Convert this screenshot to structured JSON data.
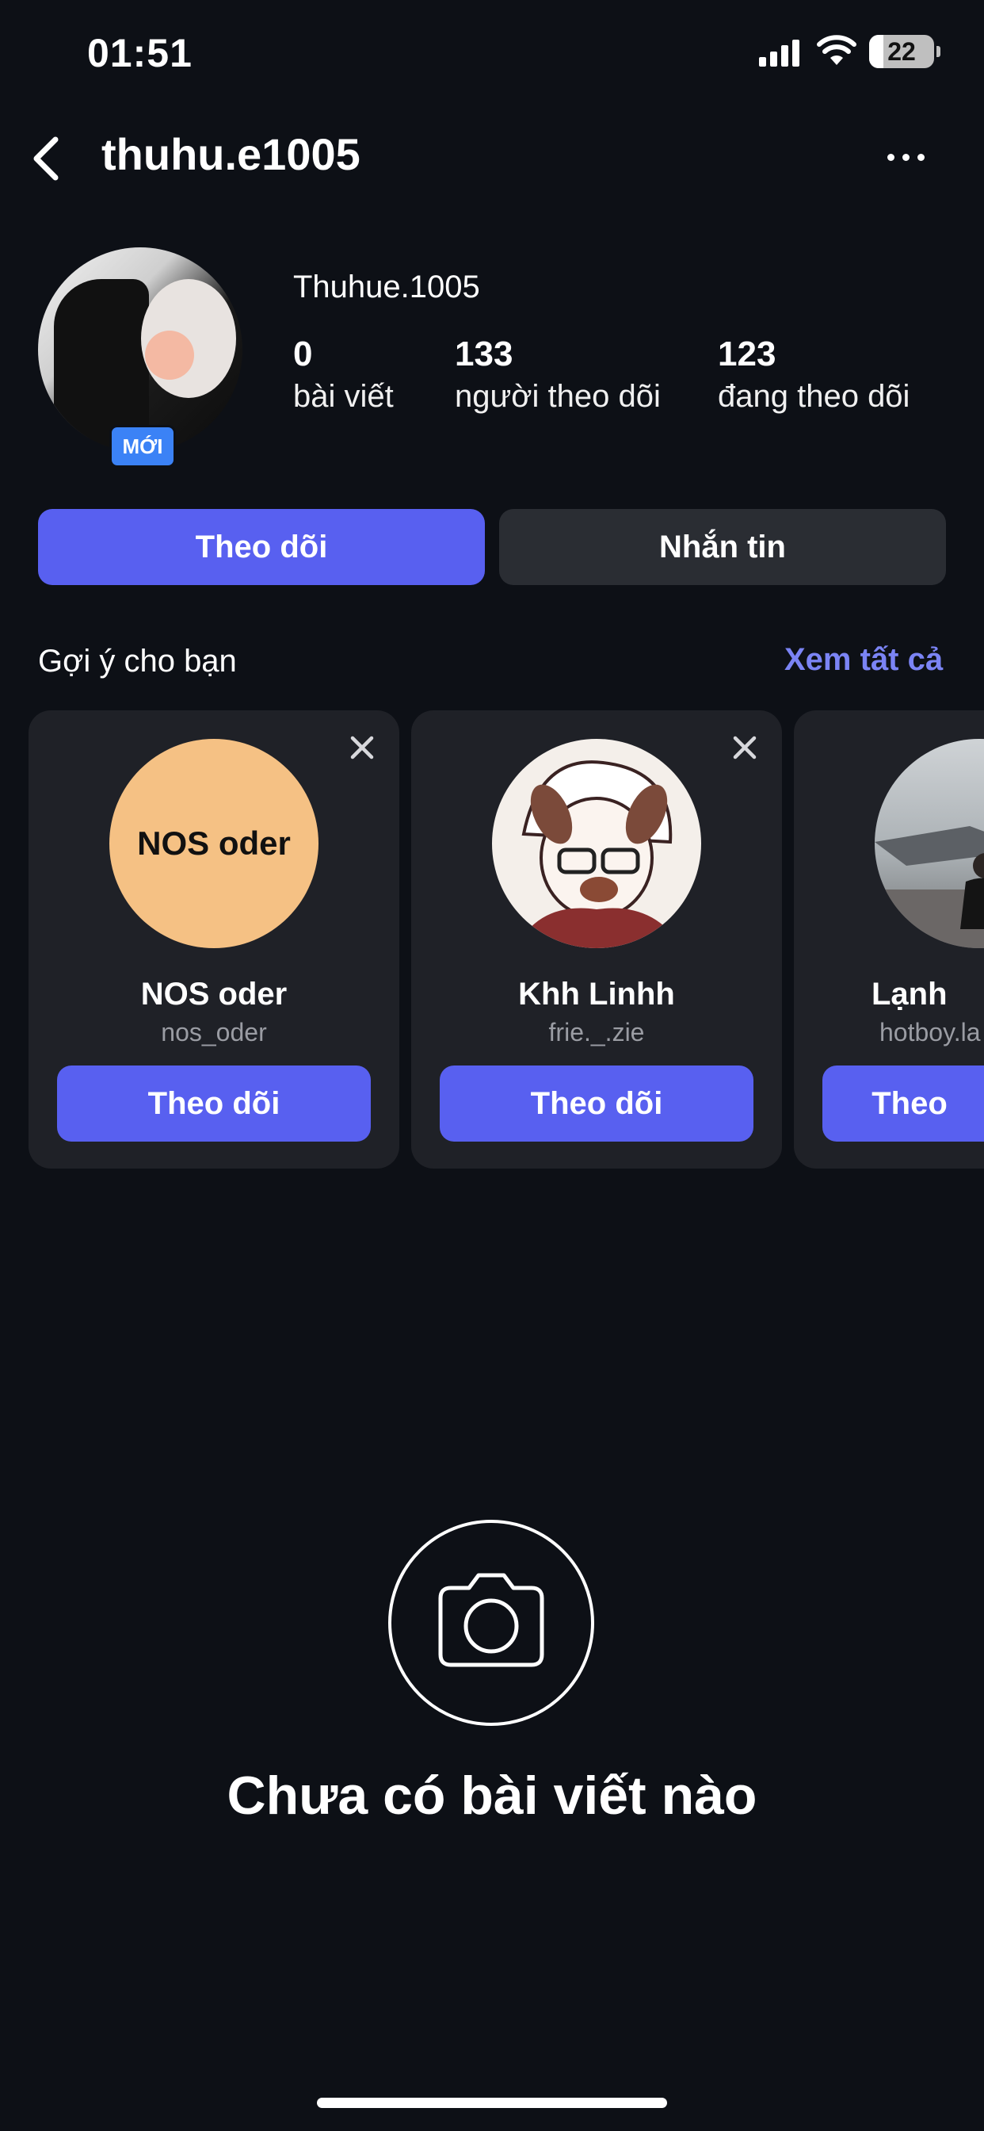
{
  "status_bar": {
    "time": "01:51",
    "battery": "22"
  },
  "header": {
    "username": "thuhu.e1005"
  },
  "profile": {
    "display_name": "Thuhue.1005",
    "badge": "MỚI",
    "stats": [
      {
        "value": "0",
        "label": "bài viết"
      },
      {
        "value": "133",
        "label": "người theo dõi"
      },
      {
        "value": "123",
        "label": "đang theo dõi"
      }
    ]
  },
  "actions": {
    "follow": "Theo dõi",
    "message": "Nhắn tin"
  },
  "suggestions": {
    "title": "Gợi ý cho bạn",
    "see_all": "Xem tất cả",
    "cards": [
      {
        "name": "NOS oder",
        "handle": "nos_oder",
        "avatar_text": "NOS oder",
        "button": "Theo dõi"
      },
      {
        "name": "Khh Linhh",
        "handle": "frie._.zie",
        "button": "Theo dõi"
      },
      {
        "name": "Lạnh",
        "handle": "hotboy.la",
        "button": "Theo"
      }
    ]
  },
  "empty_state": {
    "text": "Chưa có bài viết nào"
  },
  "icons": [
    "back-arrow-icon",
    "more-options-icon",
    "close-icon",
    "camera-icon",
    "signal-icon",
    "wifi-icon",
    "battery-icon"
  ],
  "colors": {
    "background": "#0d1016",
    "accent": "#5860f0",
    "link": "#7b84f5",
    "card": "#1f2127",
    "badge": "#3b82f6"
  }
}
